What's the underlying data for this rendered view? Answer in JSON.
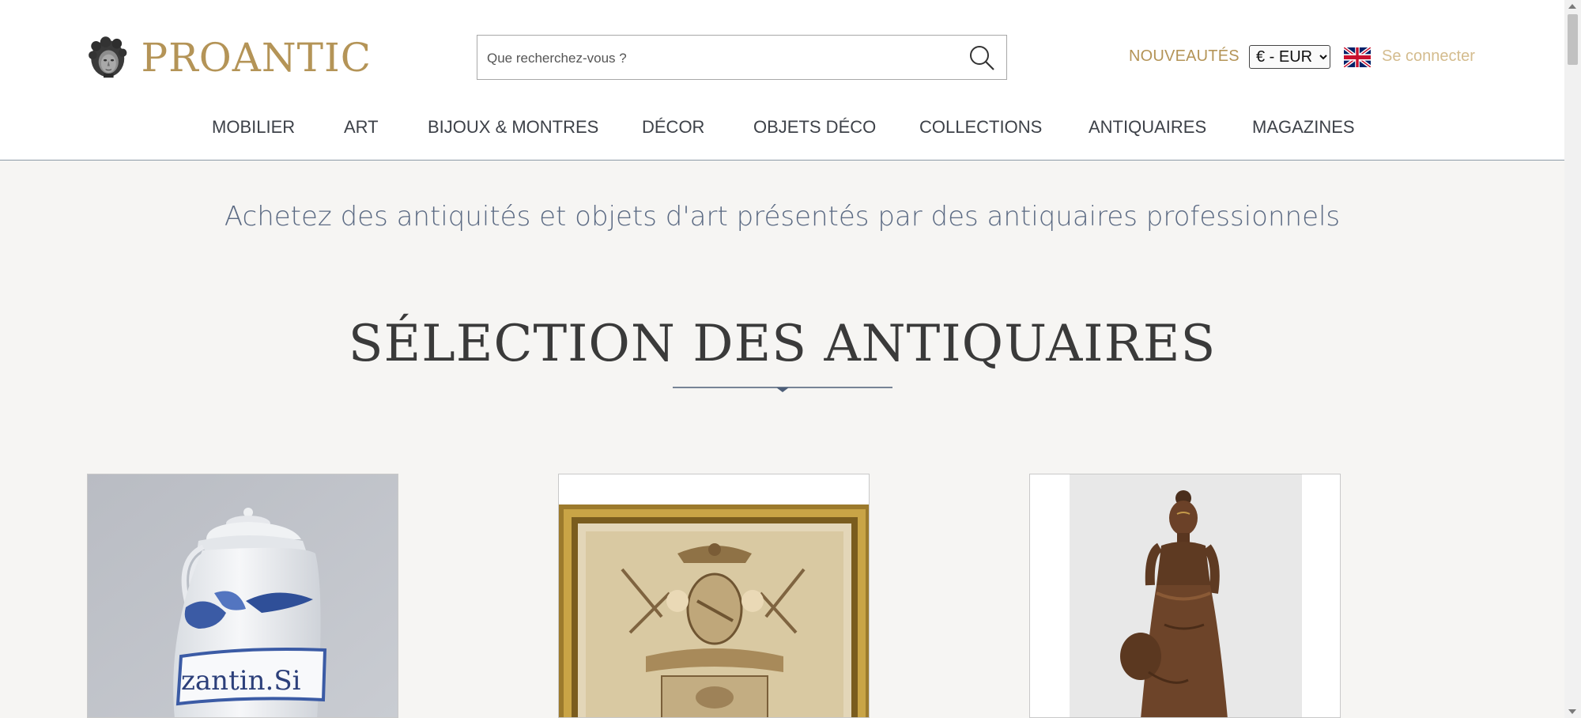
{
  "header": {
    "logo_text": "PROANTIC",
    "search": {
      "placeholder": "Que recherchez-vous ?",
      "value": ""
    },
    "nouveautes_label": "NOUVEAUTÉS",
    "currency": {
      "selected": "€ - EUR"
    },
    "language_flag": "uk-flag-icon",
    "login_label": "Se connecter",
    "nav": [
      {
        "label": "MOBILIER"
      },
      {
        "label": "ART"
      },
      {
        "label": "BIJOUX & MONTRES"
      },
      {
        "label": "DÉCOR"
      },
      {
        "label": "OBJETS DÉCO"
      },
      {
        "label": "COLLECTIONS"
      },
      {
        "label": "ANTIQUAIRES"
      },
      {
        "label": "MAGAZINES"
      }
    ]
  },
  "main": {
    "tagline": "Achetez des antiquités et objets d'art présentés par des antiquaires professionnels",
    "section_title": "SÉLECTION DES ANTIQUAIRES",
    "cards": [
      {
        "image": "faience-pharmacy-jug",
        "jar_label": "zantin.Si"
      },
      {
        "image": "framed-engraving-coat-of-arms"
      },
      {
        "image": "bronze-statue-woman"
      }
    ]
  },
  "colors": {
    "brand_gold": "#b49457",
    "nav_text": "#3d4148",
    "tagline": "#5b6a83",
    "background": "#f6f5f3"
  }
}
